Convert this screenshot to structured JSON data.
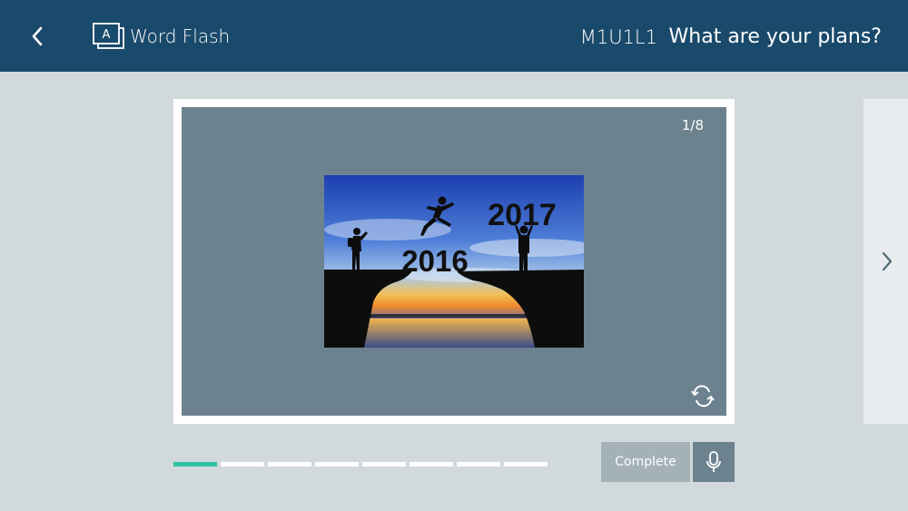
{
  "header": {
    "app_title": "Word Flash",
    "lesson_code": "M1U1L1",
    "lesson_title": "What are your plans?",
    "back_icon": "chevron-left-icon",
    "logo_icon": "word-flash-logo-icon",
    "logo_letter": "A",
    "background": "#1a4a6b"
  },
  "card": {
    "counter": "1/8",
    "image": {
      "year_left": "2016",
      "year_right": "2017"
    },
    "flip_icon": "flip-arrows-icon"
  },
  "navigation": {
    "next_icon": "chevron-right-icon"
  },
  "progress": {
    "total": 8,
    "current": 1,
    "active_color": "#2fc1a2"
  },
  "actions": {
    "complete_label": "Complete",
    "mic_icon": "microphone-icon"
  }
}
